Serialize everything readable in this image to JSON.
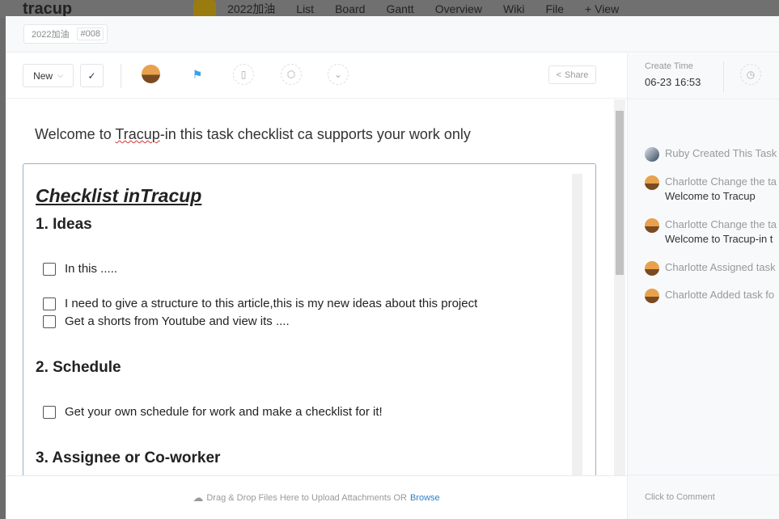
{
  "background": {
    "logo": "tracup",
    "project": "2022加油",
    "views": [
      "List",
      "Board",
      "Gantt",
      "Overview",
      "Wiki",
      "File",
      "+ View"
    ]
  },
  "breadcrumb": {
    "project": "2022加油",
    "task_id": "#008"
  },
  "toolbar": {
    "status": "New",
    "share": "Share"
  },
  "right": {
    "create_time_label": "Create Time",
    "create_time": "06-23 16:53",
    "history": [
      {
        "text": "Ruby Created This Task",
        "sub": ""
      },
      {
        "text": "Charlotte Change the ta",
        "sub": "Welcome to Tracup"
      },
      {
        "text": "Charlotte Change the ta",
        "sub": "Welcome to Tracup-in t"
      },
      {
        "text": "Charlotte Assigned task",
        "sub": ""
      },
      {
        "text": "Charlotte Added task fo",
        "sub": ""
      }
    ],
    "comment": "Click to Comment"
  },
  "task": {
    "title_pre": "Welcome to ",
    "title_link": "Tracup",
    "title_post": "-in this task checklist ca supports your work only"
  },
  "editor": {
    "heading": "Checklist inTracup",
    "sections": [
      {
        "title": "1. Ideas",
        "items": [
          "In this .....",
          "I need to give a structure to this article,this is my new ideas about this project",
          "Get a shorts from Youtube and view its ...."
        ]
      },
      {
        "title": "2. Schedule",
        "items": [
          "Get your own schedule for work and make a checklist for it!"
        ]
      },
      {
        "title": "3. Assignee or Co-worker",
        "items": []
      }
    ]
  },
  "footer": {
    "text": "Drag & Drop Files Here to Upload Attachments OR",
    "link": "Browse"
  }
}
